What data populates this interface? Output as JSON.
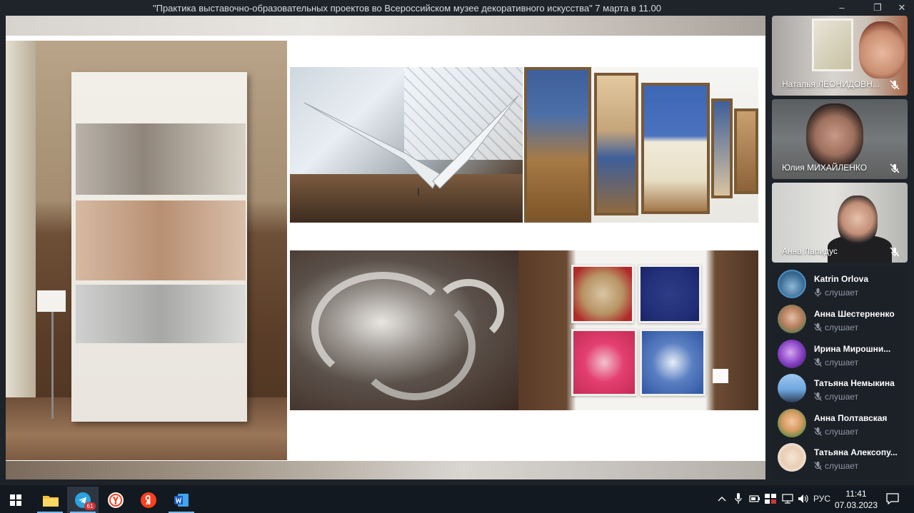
{
  "window": {
    "title": "\"Практика выставочно-образовательных проектов во Всероссийском музее декоративного искусства\" 7 марта в 11.00"
  },
  "video_tiles": [
    {
      "name": "Наталья ЛЕОНИДОВН..."
    },
    {
      "name": "Юлия МИХАЙЛЕНКО"
    },
    {
      "name": "Анна Лапидус"
    }
  ],
  "participants": [
    {
      "name": "Katrin Orlova",
      "status": "слушает",
      "mic": "on"
    },
    {
      "name": "Анна Шестерненко",
      "status": "слушает",
      "mic": "off"
    },
    {
      "name": "Ирина Мирошни...",
      "status": "слушает",
      "mic": "off"
    },
    {
      "name": "Татьяна Немыкина",
      "status": "слушает",
      "mic": "off"
    },
    {
      "name": "Анна Полтавская",
      "status": "слушает",
      "mic": "off"
    },
    {
      "name": "Татьяна Алексопу...",
      "status": "слушает",
      "mic": "off"
    }
  ],
  "taskbar": {
    "telegram_badge": "61",
    "language": "РУС",
    "time": "11:41",
    "date": "07.03.2023",
    "apps": [
      "windows-start-icon",
      "file-explorer-icon",
      "telegram-icon",
      "yandex-browser-icon",
      "yandex-icon",
      "word-icon"
    ]
  },
  "colors": {
    "accent": "#76b9ed",
    "panel_bg": "#1e2229",
    "status_text": "#8c96a3",
    "badge": "#d13438"
  }
}
